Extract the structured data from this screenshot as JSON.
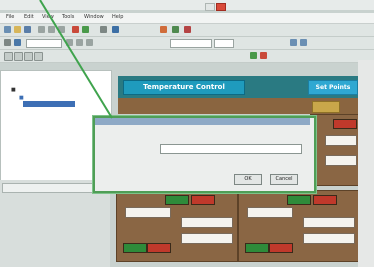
{
  "menubar": {
    "items": [
      "File",
      "Edit",
      "View",
      "Tools",
      "Window",
      "Help"
    ]
  },
  "dialog": {
    "ok_label": "OK",
    "cancel_label": "Cancel"
  },
  "hmi": {
    "title": "Temperature Control",
    "setpoints_label": "Set Points"
  },
  "colors": {
    "hmi_bg": "#2a7a82",
    "title_button": "#1f9bbd",
    "panel_brown": "#8a6644",
    "dialog_highlight": "#4f9e56",
    "button_red": "#c0392b",
    "button_green": "#2e8b3a"
  }
}
